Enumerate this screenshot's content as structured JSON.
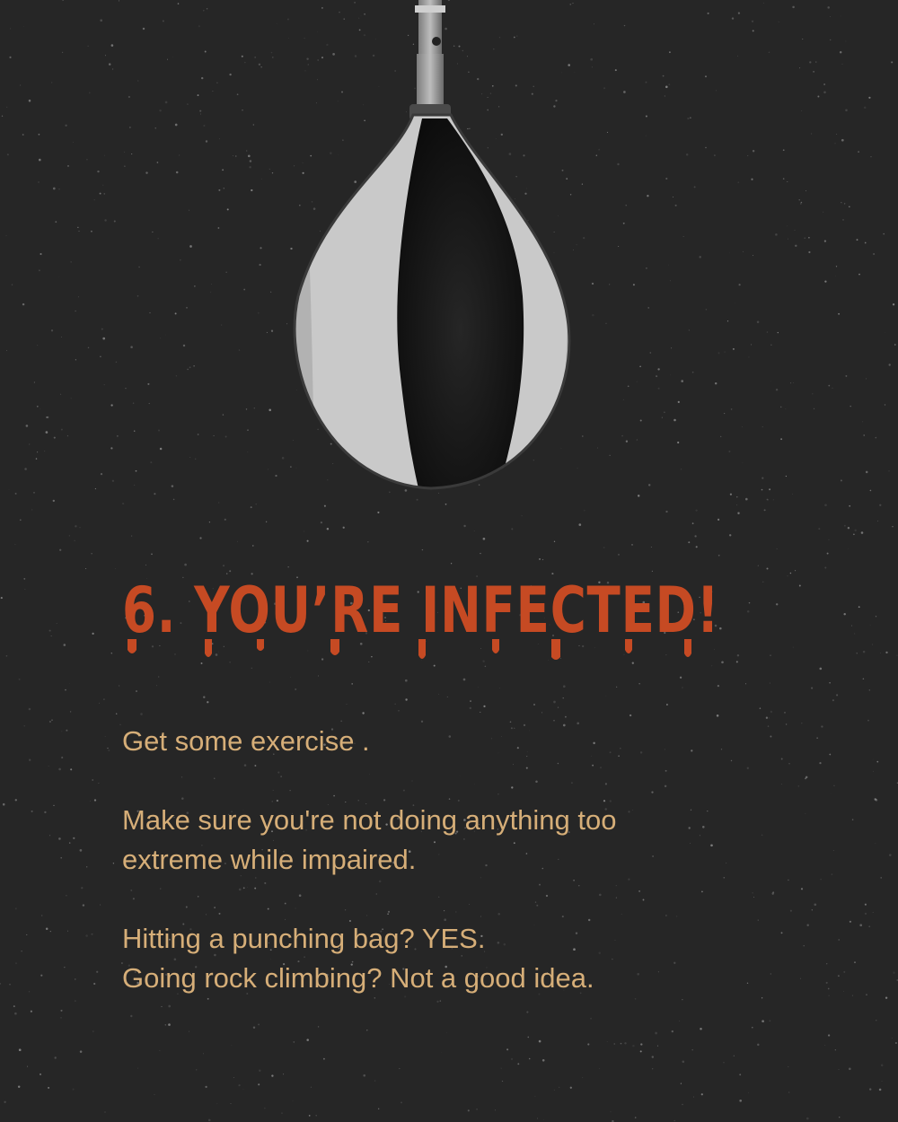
{
  "poster": {
    "headline": "6. YOU’RE INFECTED!",
    "paragraphs": [
      {
        "lines": [
          "Get some exercise ."
        ]
      },
      {
        "lines": [
          "Make sure you're not doing anything too",
          "extreme while impaired."
        ]
      },
      {
        "lines": [
          "Hitting a punching bag? YES.",
          "Going rock climbing? Not a good idea."
        ]
      }
    ]
  },
  "colors": {
    "background": "#262626",
    "headline": "#c64a23",
    "body_text": "#d6ae78",
    "bag_light": "#c9c9c9",
    "bag_dark": "#141414"
  },
  "illustration": {
    "name": "speed-bag-icon"
  }
}
